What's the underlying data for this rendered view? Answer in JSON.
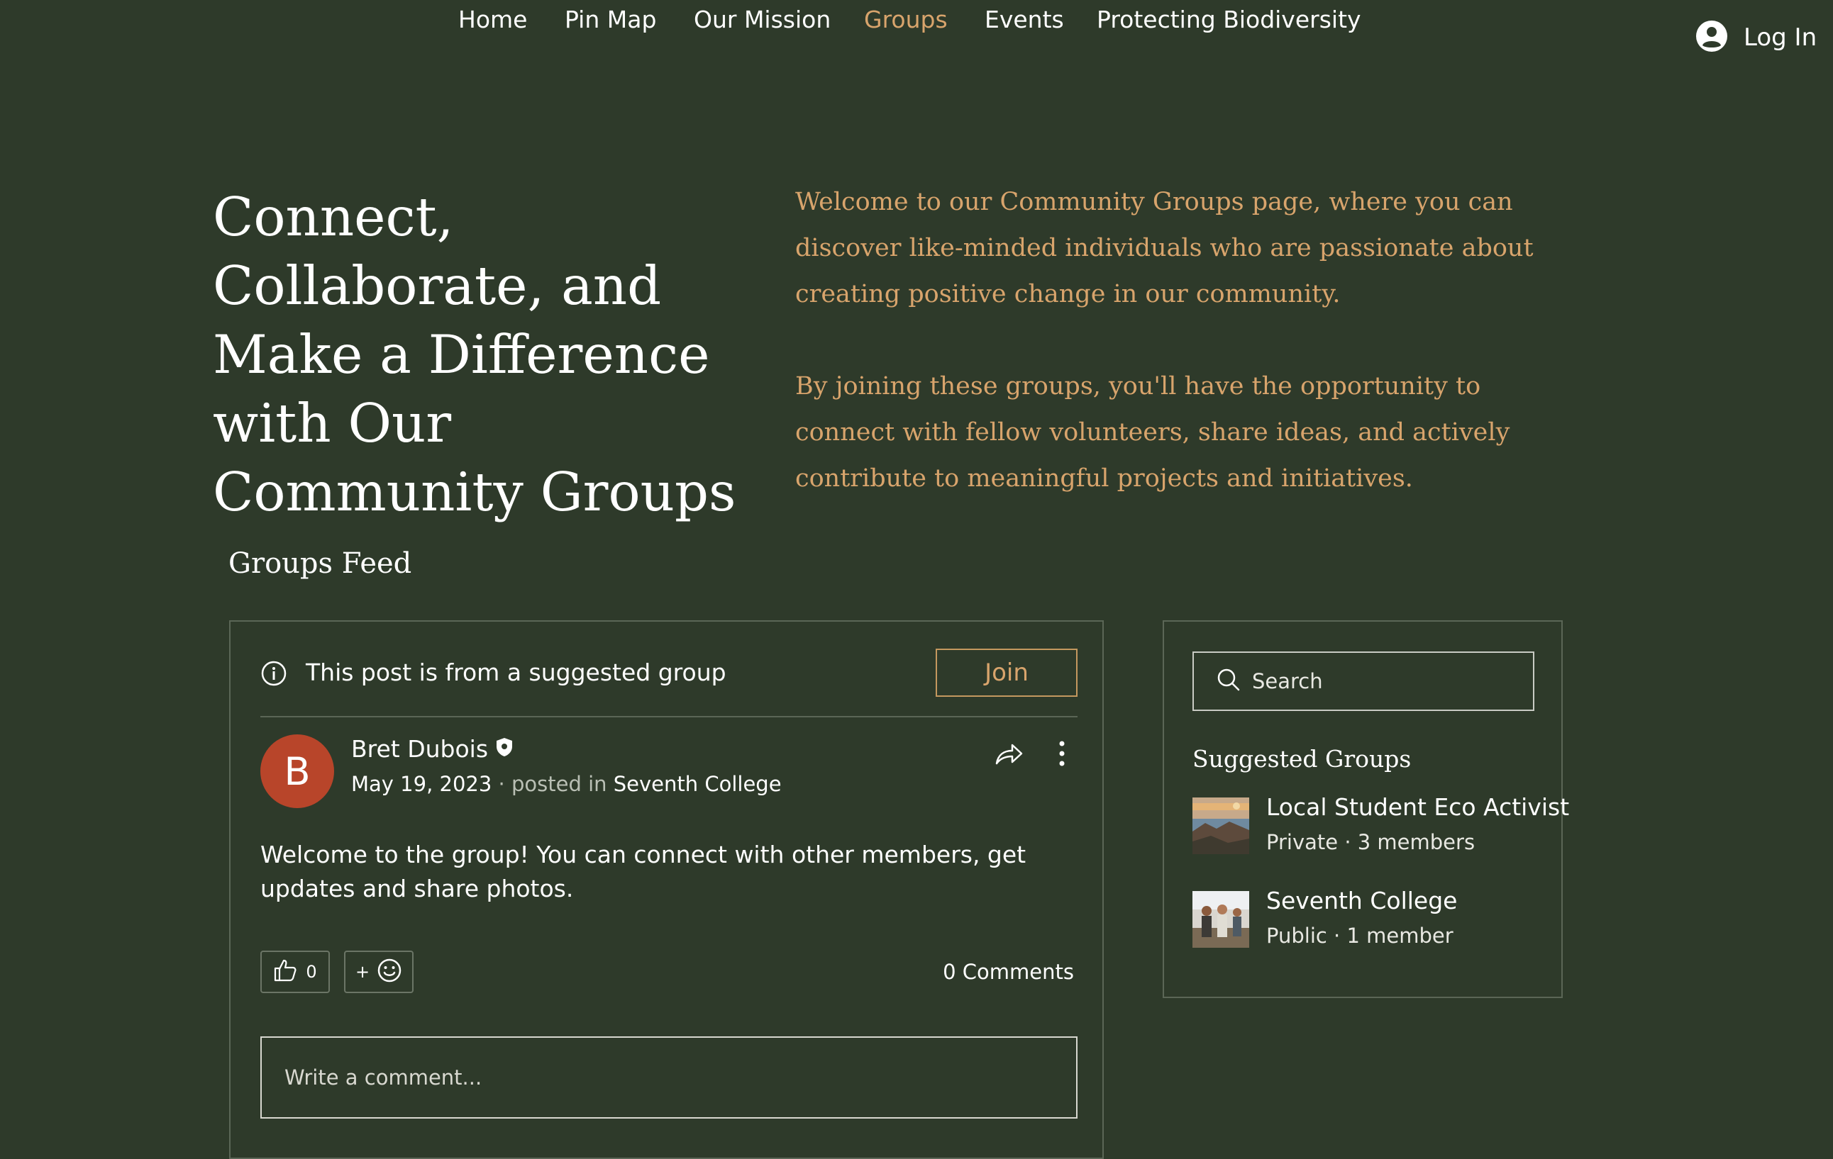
{
  "nav": {
    "items": [
      {
        "label": "Home",
        "active": false
      },
      {
        "label": "Pin Map",
        "active": false
      },
      {
        "label": "Our Mission",
        "active": false
      },
      {
        "label": "Groups",
        "active": true
      },
      {
        "label": "Events",
        "active": false
      },
      {
        "label": "Protecting Biodiversity",
        "active": false
      }
    ],
    "login_label": "Log In",
    "login_icon": "user-circle-icon"
  },
  "hero": {
    "title": "Connect, Collaborate, and Make a Difference with Our Community Groups",
    "paragraphs": [
      "Welcome to our Community Groups page, where you can discover like-minded individuals who are passionate about creating positive change in our community.",
      "By joining these groups, you'll have the opportunity to connect with fellow volunteers, share ideas, and actively contribute to meaningful projects and initiatives."
    ]
  },
  "feed": {
    "title": "Groups Feed",
    "post": {
      "suggested_notice": "This post is from a suggested group",
      "join_label": "Join",
      "avatar_initial": "B",
      "author": "Bret Dubois",
      "date": "May 19, 2023",
      "posted_in_label": " · posted in ",
      "group": "Seventh College",
      "body": "Welcome to the group! You can connect with other members, get updates and share photos.",
      "like_count": "0",
      "react_plus": "+",
      "comments": "0 Comments",
      "comment_placeholder": "Write a comment..."
    }
  },
  "sidebar": {
    "search_placeholder": "Search",
    "suggested_title": "Suggested Groups",
    "groups": [
      {
        "name": "Local Student Eco Activist",
        "meta": "Private · 3 members"
      },
      {
        "name": "Seventh College",
        "meta": "Public · 1 member"
      }
    ]
  },
  "colors": {
    "background": "#2e3a2a",
    "accent": "#d8a46c",
    "avatar": "#b8452a"
  }
}
